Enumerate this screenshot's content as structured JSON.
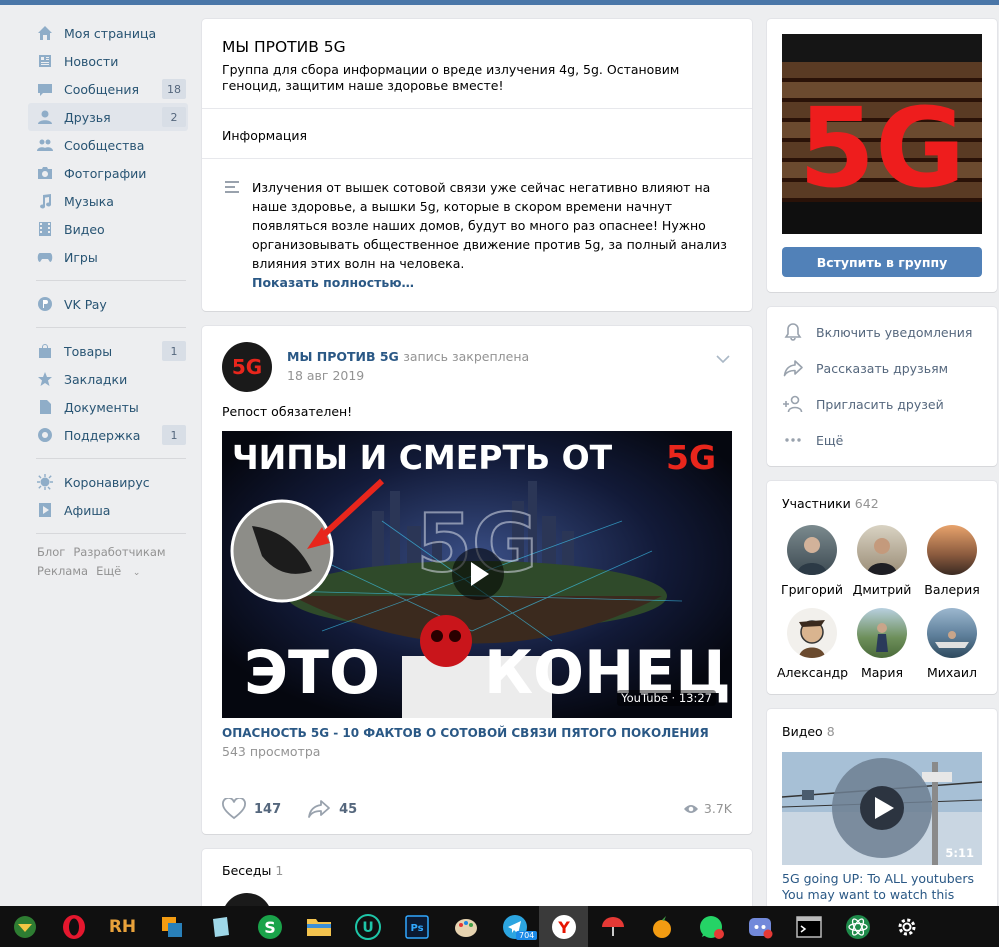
{
  "sidebar": {
    "items": [
      {
        "label": "Моя страница",
        "icon": "home-icon"
      },
      {
        "label": "Новости",
        "icon": "news-icon"
      },
      {
        "label": "Сообщения",
        "icon": "messages-icon",
        "badge": "18"
      },
      {
        "label": "Друзья",
        "icon": "friends-icon",
        "badge": "2",
        "active": true
      },
      {
        "label": "Сообщества",
        "icon": "communities-icon"
      },
      {
        "label": "Фотографии",
        "icon": "photos-icon"
      },
      {
        "label": "Музыка",
        "icon": "music-icon"
      },
      {
        "label": "Видео",
        "icon": "video-icon"
      },
      {
        "label": "Игры",
        "icon": "games-icon"
      }
    ],
    "pay": {
      "label": "VK Pay",
      "icon": "vkpay-icon"
    },
    "items2": [
      {
        "label": "Товары",
        "icon": "market-icon",
        "badge": "1"
      },
      {
        "label": "Закладки",
        "icon": "bookmarks-icon"
      },
      {
        "label": "Документы",
        "icon": "documents-icon"
      },
      {
        "label": "Поддержка",
        "icon": "support-icon",
        "badge": "1"
      }
    ],
    "items3": [
      {
        "label": "Коронавирус",
        "icon": "coronavirus-icon"
      },
      {
        "label": "Афиша",
        "icon": "afisha-icon"
      }
    ],
    "footer": {
      "blog": "Блог",
      "dev": "Разработчикам",
      "ads": "Реклама",
      "more": "Ещё"
    }
  },
  "group": {
    "title": "МЫ ПРОТИВ 5G",
    "status": "Группа для сбора информации о вреде излучения 4g, 5g. Остановим геноцид, защитим наше здоровье вместе!",
    "info_title": "Информация",
    "description": "Излучения от вышек сотовой связи уже сейчас негативно влияют на наше здоровье, а вышки 5g, которые в скором времени начнут появляться возле наших домов, будут во много раз опаснее! Нужно организовывать общественное движение против 5g, за полный анализ влияния этих волн на человека.",
    "show_more": "Показать полностью…"
  },
  "post": {
    "author": "МЫ ПРОТИВ 5G",
    "pinned": "запись закреплена",
    "date": "18 авг 2019",
    "avatar_text": "5G",
    "text": "Репост обязателен!",
    "video": {
      "headline_top": "ЧИПЫ И СМЕРТЬ ОТ",
      "headline_top_accent": "5G",
      "headline_bottom_left": "ЭТО",
      "headline_bottom_right": "КОНЕЦ",
      "bg_text": "5G",
      "source": "YouTube · 13:27",
      "title": "ОПАСНОСТЬ 5G - 10 ФАКТОВ О СОТОВОЙ СВЯЗИ ПЯТОГО ПОКОЛЕНИЯ",
      "views": "543 просмотра"
    },
    "likes": "147",
    "shares": "45",
    "views": "3.7K"
  },
  "chats": {
    "title": "Беседы",
    "count": "1"
  },
  "right": {
    "cover_text": "5G",
    "join_label": "Вступить в группу",
    "actions": [
      {
        "label": "Включить уведомления",
        "icon": "bell-icon"
      },
      {
        "label": "Рассказать друзьям",
        "icon": "share-icon"
      },
      {
        "label": "Пригласить друзей",
        "icon": "add-friend-icon"
      },
      {
        "label": "Ещё",
        "icon": "more-icon"
      }
    ],
    "members": {
      "title": "Участники",
      "count": "642",
      "list": [
        "Григорий",
        "Дмитрий",
        "Валерия",
        "Александр",
        "Мария",
        "Михаил"
      ]
    },
    "videos": {
      "title": "Видео",
      "count": "8",
      "duration": "5:11",
      "item_title": "5G going UP: To ALL youtubers You may want to watch this"
    }
  },
  "taskbar": {
    "telegram_badge": "704"
  },
  "colors": {
    "accent": "#4a76a8",
    "link": "#2a5885",
    "button": "#5181b8",
    "red5g": "#e8261c"
  }
}
